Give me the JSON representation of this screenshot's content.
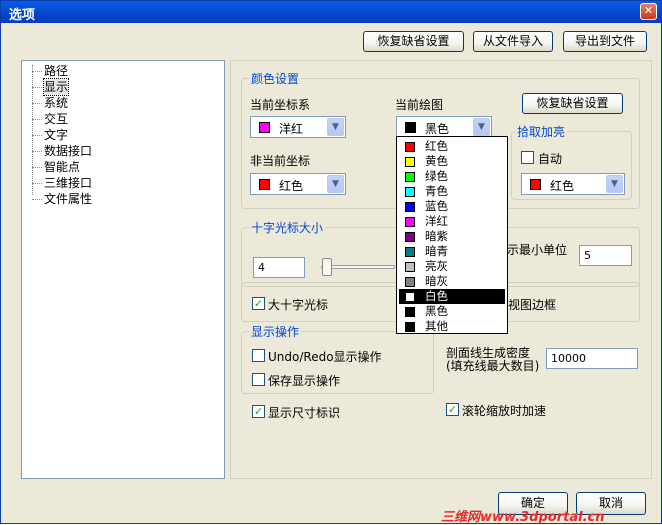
{
  "window": {
    "title": "选项",
    "close_label": "✕"
  },
  "top_buttons": {
    "restore_defaults": "恢复缺省设置",
    "import_file": "从文件导入",
    "export_file": "导出到文件"
  },
  "tree": {
    "items": [
      {
        "label": "路径"
      },
      {
        "label": "显示"
      },
      {
        "label": "系统"
      },
      {
        "label": "交互"
      },
      {
        "label": "文字"
      },
      {
        "label": "数据接口"
      },
      {
        "label": "智能点"
      },
      {
        "label": "三维接口"
      },
      {
        "label": "文件属性"
      }
    ],
    "selected": "显示"
  },
  "color_settings": {
    "title": "颜色设置",
    "current_coord_label": "当前坐标系",
    "current_coord_value": "洋红",
    "current_coord_color": "#ff00ff",
    "current_draw_label": "当前绘图",
    "current_draw_value": "黑色",
    "current_draw_color": "#000000",
    "restore_defaults": "恢复缺省设置",
    "noncurrent_coord_label": "非当前坐标",
    "noncurrent_coord_value": "红色",
    "noncurrent_coord_color": "#ff0000",
    "highlight": {
      "title": "拾取加亮",
      "auto_label": "自动",
      "auto_checked": false,
      "color_value": "红色",
      "color": "#ff0000"
    }
  },
  "color_dropdown": {
    "items": [
      {
        "label": "红色",
        "color": "#ff0000"
      },
      {
        "label": "黄色",
        "color": "#ffff00"
      },
      {
        "label": "绿色",
        "color": "#00ff00"
      },
      {
        "label": "青色",
        "color": "#00ffff"
      },
      {
        "label": "蓝色",
        "color": "#0000ff"
      },
      {
        "label": "洋红",
        "color": "#ff00ff"
      },
      {
        "label": "暗紫",
        "color": "#800080"
      },
      {
        "label": "暗青",
        "color": "#008080"
      },
      {
        "label": "亮灰",
        "color": "#c0c0c0"
      },
      {
        "label": "暗灰",
        "color": "#808080"
      },
      {
        "label": "白色",
        "color": "#ffffff"
      },
      {
        "label": "黑色",
        "color": "#000000"
      },
      {
        "label": "其他",
        "color": "#000000"
      }
    ],
    "highlighted": "白色"
  },
  "crosshair": {
    "title": "十字光标大小",
    "size_value": "4",
    "min_unit_label": "示最小单位",
    "min_unit_value": "5",
    "big_crosshair_label": "大十字光标",
    "big_crosshair_checked": true,
    "view_border_label": "视图边框"
  },
  "display_ops": {
    "title": "显示操作",
    "undo_redo_label": "Undo/Redo显示操作",
    "undo_redo_checked": false,
    "save_display_label": "保存显示操作",
    "save_display_checked": false,
    "hatch_density_label_1": "剖面线生成密度",
    "hatch_density_label_2": "(填充线最大数目)",
    "hatch_density_value": "10000"
  },
  "show_dim_label": "显示尺寸标识",
  "show_dim_checked": true,
  "wheel_zoom_label": "滚轮缩放时加速",
  "wheel_zoom_checked": true,
  "bottom_buttons": {
    "ok": "确定",
    "cancel": "取消"
  },
  "watermark": "三维网www.3dportal.cn"
}
